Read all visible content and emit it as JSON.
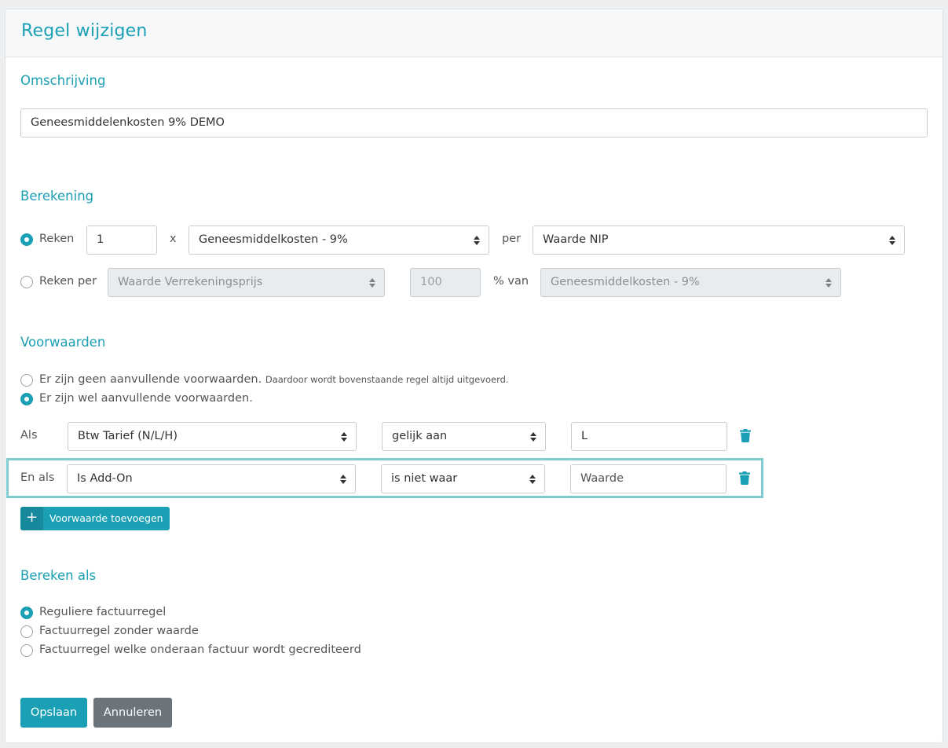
{
  "header": {
    "title": "Regel wijzigen"
  },
  "omschrijving": {
    "title": "Omschrijving",
    "value": "Geneesmiddelenkosten 9% DEMO"
  },
  "berekening": {
    "title": "Berekening",
    "row1": {
      "radio_label": "Reken",
      "checked": true,
      "amount": "1",
      "times": "x",
      "select1": "Geneesmiddelkosten - 9%",
      "per": "per",
      "select2": "Waarde NIP"
    },
    "row2": {
      "radio_label": "Reken per",
      "checked": false,
      "select1": "Waarde Verrekeningsprijs",
      "percent_placeholder": "100",
      "percent_of": "% van",
      "select2": "Geneesmiddelkosten - 9%"
    }
  },
  "voorwaarden": {
    "title": "Voorwaarden",
    "option_none": "Er zijn geen aanvullende voorwaarden.",
    "option_none_note": "Daardoor wordt bovenstaande regel altijd uitgevoerd.",
    "option_some": "Er zijn wel aanvullende voorwaarden.",
    "conditions": [
      {
        "prefix": "Als",
        "field": "Btw Tarief (N/L/H)",
        "operator": "gelijk aan",
        "value": "L",
        "placeholder": ""
      },
      {
        "prefix": "En als",
        "field": "Is Add-On",
        "operator": "is niet waar",
        "value": "",
        "placeholder": "Waarde"
      }
    ],
    "add_button_icon": "+",
    "add_button": "Voorwaarde toevoegen"
  },
  "bereken_als": {
    "title": "Bereken als",
    "options": [
      "Reguliere factuurregel",
      "Factuurregel zonder waarde",
      "Factuurregel welke onderaan factuur wordt gecrediteerd"
    ],
    "selected_index": 0
  },
  "actions": {
    "save": "Opslaan",
    "cancel": "Annuleren"
  },
  "colors": {
    "accent": "#1a9fb4",
    "highlight": "#7fcdd2",
    "secondary": "#6b737b"
  },
  "icons": {
    "delete": "trash-icon",
    "add": "plus-icon",
    "select": "sort-arrows-icon"
  }
}
